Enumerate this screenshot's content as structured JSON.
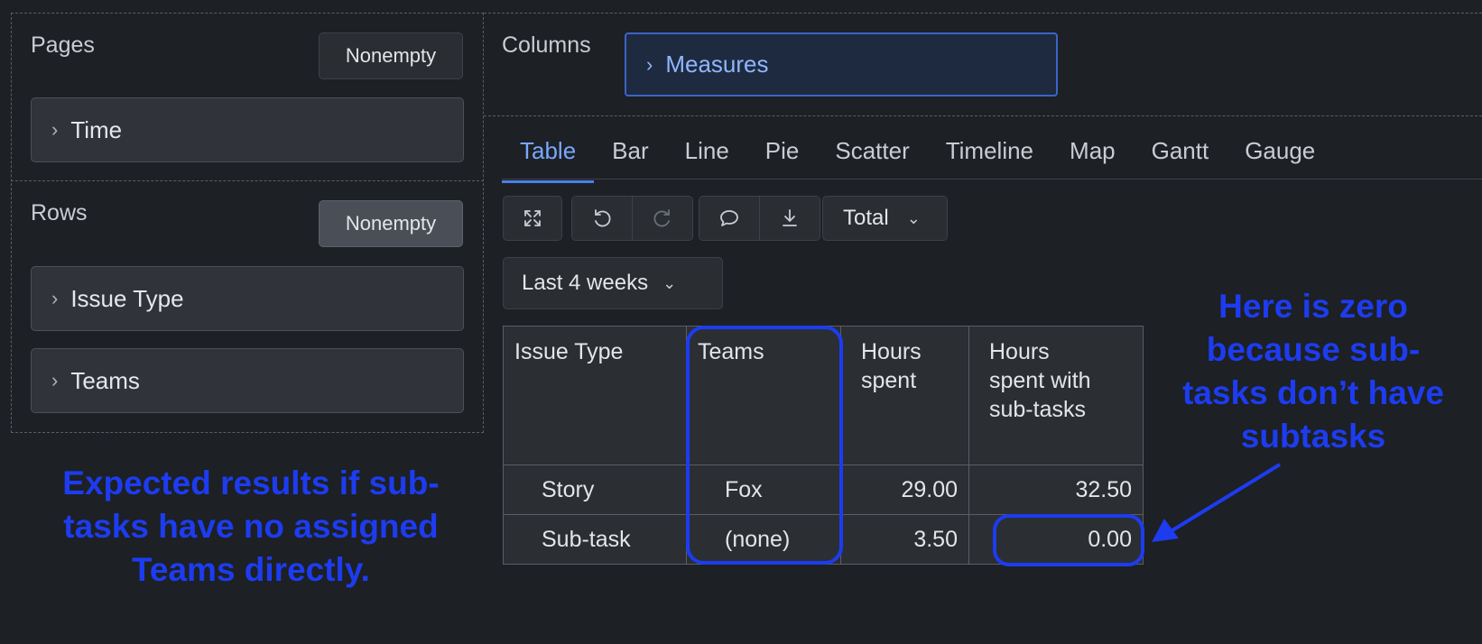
{
  "pages": {
    "label": "Pages",
    "nonempty": "Nonempty",
    "dimension": "Time"
  },
  "rows": {
    "label": "Rows",
    "nonempty": "Nonempty",
    "dimensions": [
      "Issue Type",
      "Teams"
    ]
  },
  "columns": {
    "label": "Columns",
    "dimension": "Measures"
  },
  "tabs": [
    "Table",
    "Bar",
    "Line",
    "Pie",
    "Scatter",
    "Timeline",
    "Map",
    "Gantt",
    "Gauge"
  ],
  "active_tab": "Table",
  "toolbar": {
    "icons": [
      "expand-icon",
      "undo-icon",
      "redo-icon",
      "comment-icon",
      "download-icon"
    ],
    "total_label": "Total",
    "period_label": "Last 4 weeks"
  },
  "table": {
    "headers": [
      "Issue Type",
      "Teams",
      "Hours spent",
      "Hours spent with sub-tasks"
    ],
    "rows": [
      [
        "Story",
        "Fox",
        "29.00",
        "32.50"
      ],
      [
        "Sub-task",
        "(none)",
        "3.50",
        "0.00"
      ]
    ]
  },
  "annotations": {
    "left": "Expected results if sub-tasks have no assigned Teams directly.",
    "right": "Here is zero because sub-tasks don’t have subtasks"
  },
  "colors": {
    "annotation": "#1d3cf0",
    "accent": "#78a8ff",
    "background": "#1d2024"
  }
}
